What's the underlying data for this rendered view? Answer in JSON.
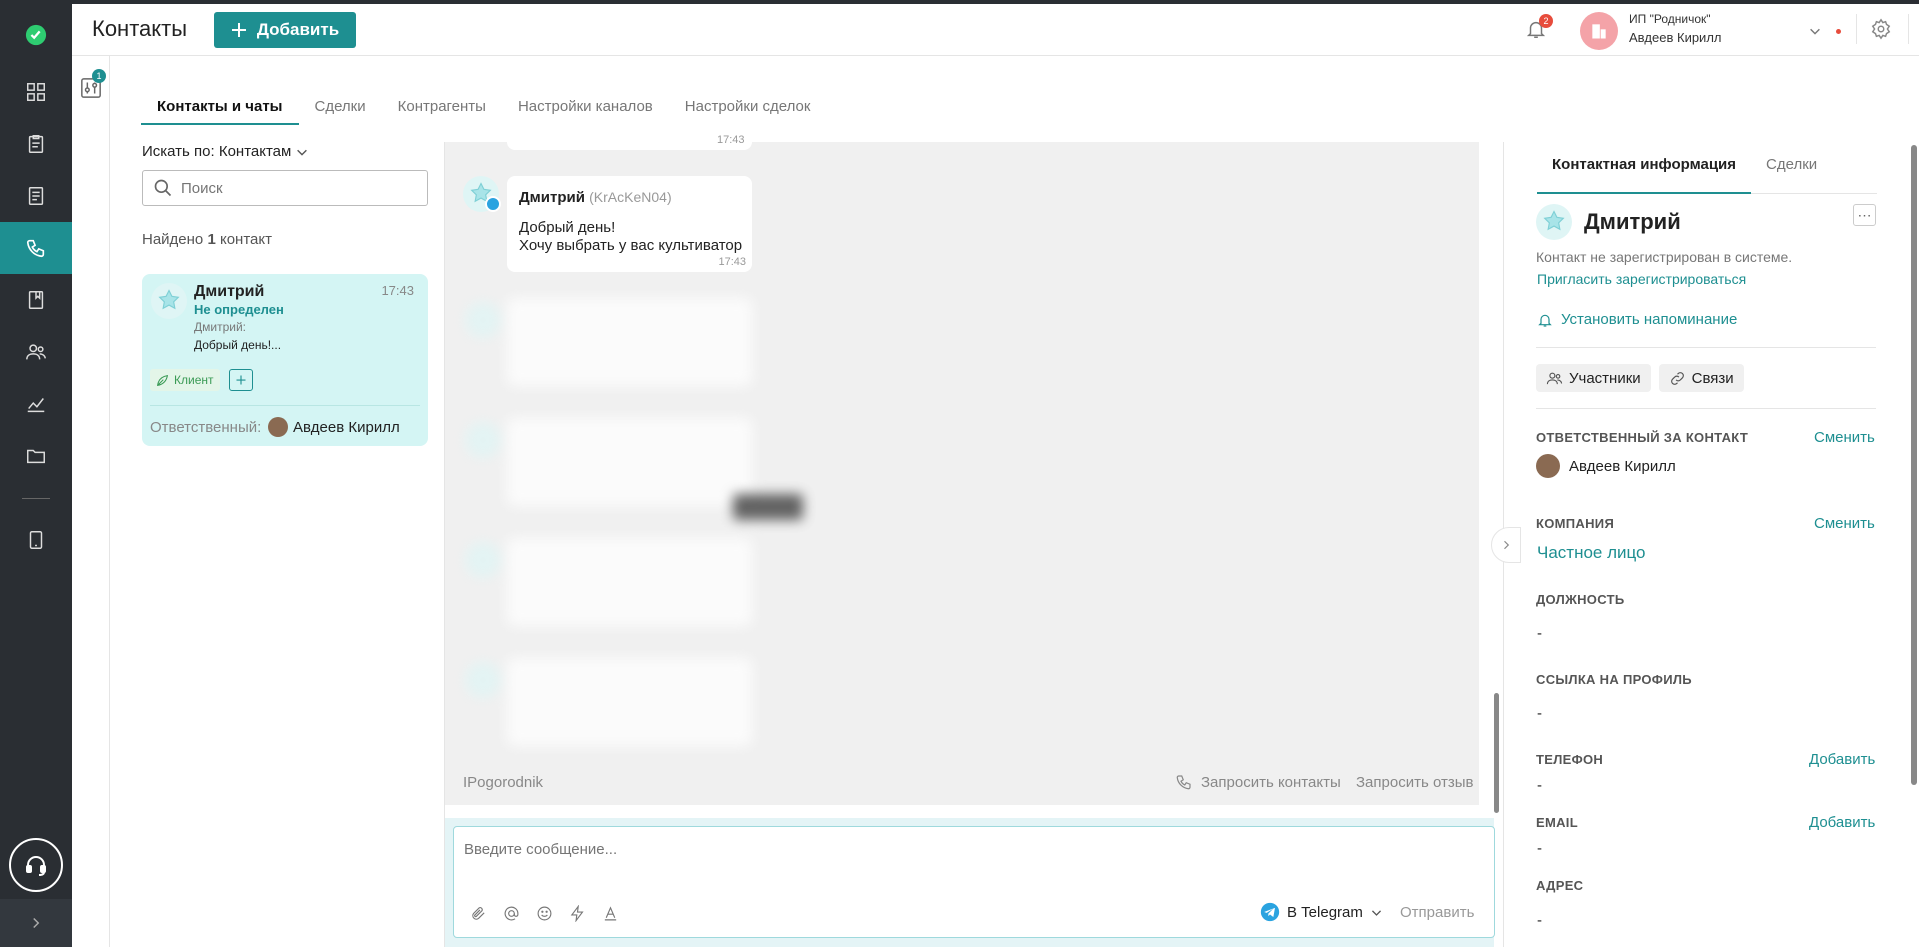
{
  "app": {
    "title": "Контакты",
    "add_button": "Добавить",
    "filter_badge": "1"
  },
  "header": {
    "notif_count": "2",
    "org_name": "ИП \"Родничок\"",
    "user_name": "Авдеев Кирилл"
  },
  "tabs": [
    {
      "label": "Контакты и чаты",
      "active": true
    },
    {
      "label": "Сделки"
    },
    {
      "label": "Контрагенты"
    },
    {
      "label": "Настройки каналов"
    },
    {
      "label": "Настройки сделок"
    }
  ],
  "search": {
    "by_label": "Искать по: Контактам",
    "placeholder": "Поиск",
    "found_prefix": "Найдено",
    "found_count": "1",
    "found_suffix": "контакт"
  },
  "contact_card": {
    "name": "Дмитрий",
    "time": "17:43",
    "status": "Не определен",
    "preview_sender": "Дмитрий:",
    "preview_text": "Добрый день!...",
    "tag": "Клиент",
    "responsible_label": "Ответственный:",
    "responsible_name": "Авдеев Кирилл"
  },
  "chat": {
    "prev_time": "17:43",
    "message": {
      "sender": "Дмитрий",
      "handle": "(KrAcKeN04)",
      "line1": "Добрый день!",
      "line2": "Хочу выбрать у вас культиватор",
      "time": "17:43"
    },
    "footer_left": "IPogorodnik",
    "request_contacts": "Запросить контакты",
    "request_review": "Запросить отзыв",
    "input_placeholder": "Введите сообщение...",
    "channel": "В Telegram",
    "send": "Отправить"
  },
  "right_panel": {
    "tabs": [
      "Контактная информация",
      "Сделки"
    ],
    "name": "Дмитрий",
    "not_registered": "Контакт не зарегистрирован в системе.",
    "invite": "Пригласить зарегистрироваться",
    "reminder": "Установить напоминание",
    "participants": "Участники",
    "links": "Связи",
    "responsible_label": "ОТВЕТСТВЕННЫЙ ЗА КОНТАКТ",
    "change": "Сменить",
    "responsible_name": "Авдеев Кирилл",
    "company_label": "КОМПАНИЯ",
    "company_value": "Частное лицо",
    "position_label": "ДОЛЖНОСТЬ",
    "profile_label": "ССЫЛКА НА ПРОФИЛЬ",
    "phone_label": "ТЕЛЕФОН",
    "email_label": "EMAIL",
    "address_label": "АДРЕС",
    "add": "Добавить",
    "dash": "-"
  },
  "colors": {
    "accent": "#1e8f91",
    "sidebar": "#2a2e33",
    "card": "#d4f5f4",
    "tag_bg": "#e3f5e8",
    "tag_text": "#3a9a55"
  }
}
